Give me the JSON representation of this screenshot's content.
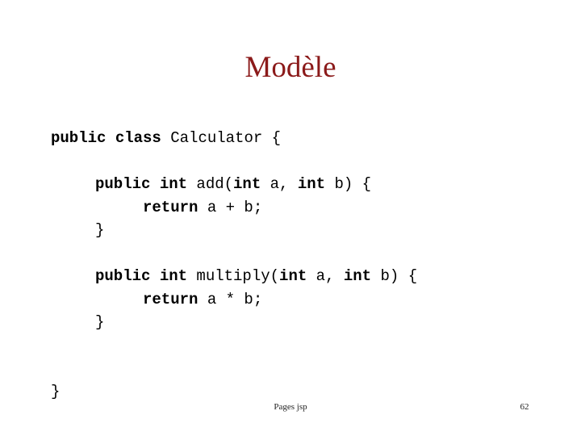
{
  "slide": {
    "title": "Modèle",
    "title_color": "#8B1A1A",
    "background_color": "#FFFFFF",
    "code_color": "#000000"
  },
  "code": {
    "language": "java",
    "lines": [
      {
        "indent": 0,
        "tokens": [
          {
            "t": "public class ",
            "b": true
          },
          {
            "t": "Calculator {",
            "b": false
          }
        ]
      },
      {
        "indent": 0,
        "tokens": []
      },
      {
        "indent": 1,
        "tokens": [
          {
            "t": "public int ",
            "b": true
          },
          {
            "t": "add(",
            "b": false
          },
          {
            "t": "int",
            "b": true
          },
          {
            "t": " a, ",
            "b": false
          },
          {
            "t": "int",
            "b": true
          },
          {
            "t": " b) {",
            "b": false
          }
        ]
      },
      {
        "indent": 2,
        "tokens": [
          {
            "t": "return",
            "b": true
          },
          {
            "t": " a + b;",
            "b": false
          }
        ]
      },
      {
        "indent": 1,
        "tokens": [
          {
            "t": "}",
            "b": false
          }
        ]
      },
      {
        "indent": 0,
        "tokens": []
      },
      {
        "indent": 1,
        "tokens": [
          {
            "t": "public int ",
            "b": true
          },
          {
            "t": "multiply(",
            "b": false
          },
          {
            "t": "int",
            "b": true
          },
          {
            "t": " a, ",
            "b": false
          },
          {
            "t": "int",
            "b": true
          },
          {
            "t": " b) {",
            "b": false
          }
        ]
      },
      {
        "indent": 2,
        "tokens": [
          {
            "t": "return",
            "b": true
          },
          {
            "t": " a * b;",
            "b": false
          }
        ]
      },
      {
        "indent": 1,
        "tokens": [
          {
            "t": "}",
            "b": false
          }
        ]
      },
      {
        "indent": 0,
        "tokens": []
      },
      {
        "indent": 0,
        "tokens": []
      },
      {
        "indent": 0,
        "tokens": [
          {
            "t": "}",
            "b": false
          }
        ]
      }
    ],
    "plain_text": "public class Calculator {\n\n    public int add(int a, int b) {\n        return a + b;\n    }\n\n    public int multiply(int a, int b) {\n        return a * b;\n    }\n\n\n}"
  },
  "footer": {
    "note": "Pages jsp",
    "page_number": "62"
  }
}
